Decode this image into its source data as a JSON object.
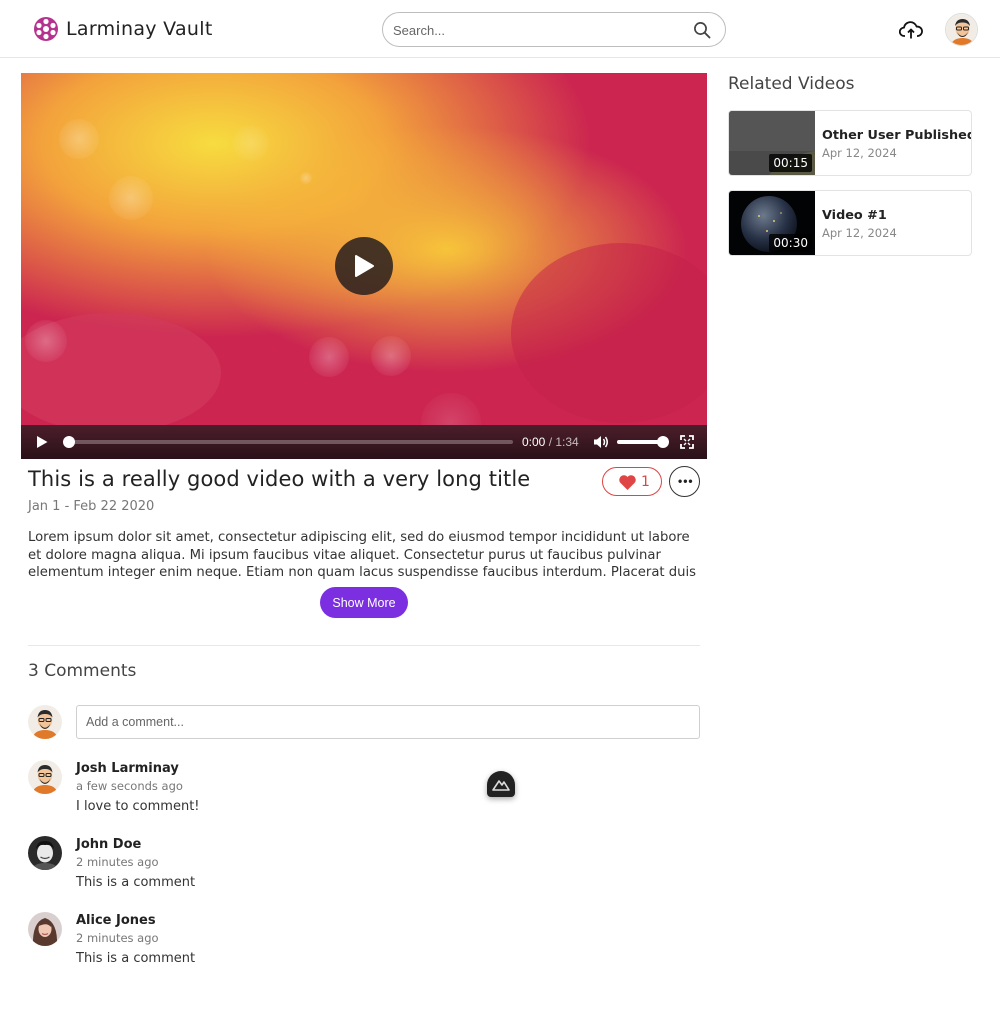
{
  "header": {
    "brand": "Larminay Vault",
    "search_placeholder": "Search...",
    "icons": [
      "logo-icon",
      "search-icon",
      "upload-cloud-icon",
      "user-avatar"
    ]
  },
  "player": {
    "current_time": "0:00",
    "duration": "/ 1:34",
    "progress": 0,
    "volume": 1.0
  },
  "video": {
    "title": "This is a really good video with a very long title",
    "date": "Jan 1 - Feb 22 2020",
    "likes": "1",
    "description": "Lorem ipsum dolor sit amet, consectetur adipiscing elit, sed do eiusmod tempor incididunt ut labore et dolore magna aliqua. Mi ipsum faucibus vitae aliquet. Consectetur purus ut faucibus pulvinar elementum integer enim neque. Etiam non quam lacus suspendisse faucibus interdum. Placerat duis ultricies lacus se...",
    "show_more_label": "Show More"
  },
  "comments": {
    "heading": "3 Comments",
    "input_placeholder": "Add a comment...",
    "items": [
      {
        "author": "Josh Larminay",
        "time": "a few seconds ago",
        "text": "I love to comment!"
      },
      {
        "author": "John Doe",
        "time": "2 minutes ago",
        "text": "This is a comment"
      },
      {
        "author": "Alice Jones",
        "time": "2 minutes ago",
        "text": "This is a comment"
      }
    ]
  },
  "related": {
    "heading": "Related Videos",
    "items": [
      {
        "title": "Other User Published",
        "date": "Apr 12, 2024",
        "duration": "00:15"
      },
      {
        "title": "Video #1",
        "date": "Apr 12, 2024",
        "duration": "00:30"
      }
    ]
  },
  "colors": {
    "accent": "#7b2fe0",
    "like": "#e04545"
  }
}
